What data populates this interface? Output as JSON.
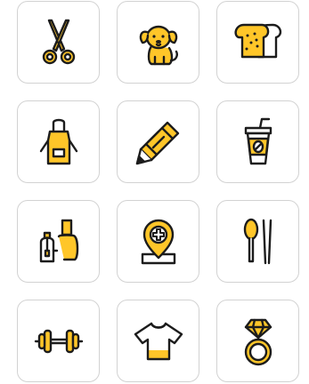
{
  "colors": {
    "accent_yellow": "#FFC629",
    "outline": "#1c1c1c",
    "tile_border": "#d2d2d2",
    "background": "#ffffff"
  },
  "icons": [
    {
      "row": 0,
      "col": 0,
      "icon": "scissors-icon"
    },
    {
      "row": 0,
      "col": 1,
      "icon": "dog-icon"
    },
    {
      "row": 0,
      "col": 2,
      "icon": "bread-icon"
    },
    {
      "row": 1,
      "col": 0,
      "icon": "apron-icon"
    },
    {
      "row": 1,
      "col": 1,
      "icon": "pencil-icon"
    },
    {
      "row": 1,
      "col": 2,
      "icon": "coffee-cup-icon"
    },
    {
      "row": 2,
      "col": 0,
      "icon": "nail-polish-icon"
    },
    {
      "row": 2,
      "col": 1,
      "icon": "medical-location-pin-icon"
    },
    {
      "row": 2,
      "col": 2,
      "icon": "spoon-chopsticks-icon"
    },
    {
      "row": 3,
      "col": 0,
      "icon": "dumbbell-icon"
    },
    {
      "row": 3,
      "col": 1,
      "icon": "t-shirt-icon"
    },
    {
      "row": 3,
      "col": 2,
      "icon": "diamond-ring-icon"
    }
  ]
}
